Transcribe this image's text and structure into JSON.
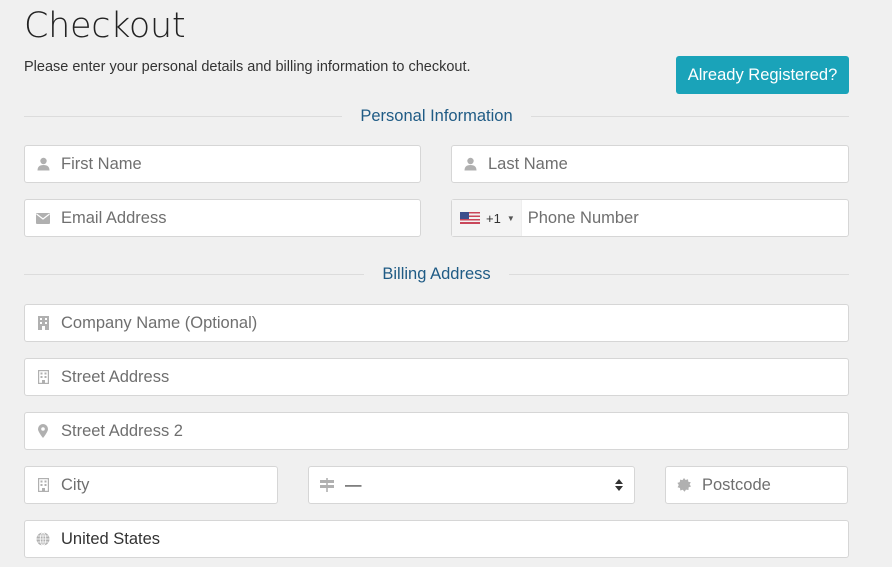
{
  "page": {
    "title": "Checkout",
    "subtitle": "Please enter your personal details and billing information to checkout.",
    "already_registered_label": "Already Registered?"
  },
  "colors": {
    "accent": "#1aa3b9",
    "section_heading": "#1f5b85",
    "background": "#f0f0f0"
  },
  "sections": {
    "personal": {
      "heading": "Personal Information",
      "first_name": {
        "placeholder": "First Name",
        "icon": "user-icon"
      },
      "last_name": {
        "placeholder": "Last Name",
        "icon": "user-icon"
      },
      "email": {
        "placeholder": "Email Address",
        "icon": "envelope-icon"
      },
      "phone": {
        "placeholder": "Phone Number",
        "country_code": "+1",
        "flag": "us-flag-icon"
      }
    },
    "billing": {
      "heading": "Billing Address",
      "company": {
        "placeholder": "Company Name (Optional)",
        "icon": "building-icon"
      },
      "street": {
        "placeholder": "Street Address",
        "icon": "building-outline-icon"
      },
      "street2": {
        "placeholder": "Street Address 2",
        "icon": "map-marker-icon"
      },
      "city": {
        "placeholder": "City",
        "icon": "building-outline-icon"
      },
      "state": {
        "value": "—",
        "icon": "signpost-icon"
      },
      "postcode": {
        "placeholder": "Postcode",
        "icon": "certificate-icon"
      },
      "country": {
        "value": "United States",
        "icon": "globe-icon"
      }
    }
  }
}
